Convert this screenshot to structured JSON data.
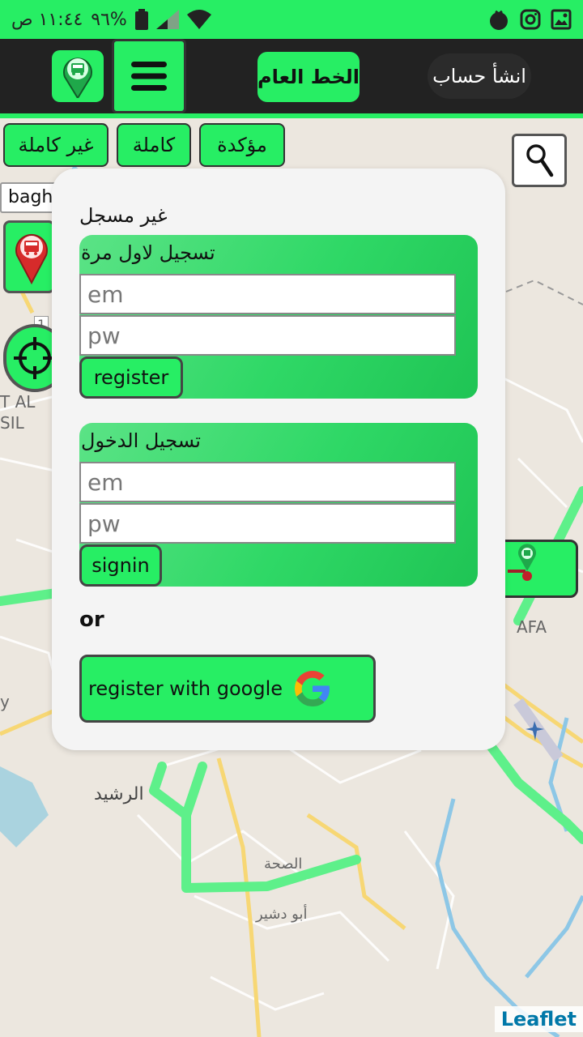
{
  "status_bar": {
    "time": "١١:٤٤ ص",
    "battery_percent": "٩٦%",
    "icons": [
      "wifi-icon",
      "signal-icon",
      "battery-icon",
      "tomato-app-icon",
      "instagram-icon",
      "gallery-icon"
    ]
  },
  "app_bar": {
    "create_account": "انشأ حساب",
    "main_line": "الخط العام",
    "menu_icon": "hamburger-menu-icon",
    "bus_pin_icon": "bus-pin-icon"
  },
  "filters": {
    "confirmed": "مؤكدة",
    "complete": "كاملة",
    "incomplete": "غير كاملة"
  },
  "map": {
    "search_value": "bagh",
    "labels": {
      "rashid": "الرشيد",
      "sihha": "الصحة",
      "abu_dshir": "أبو دشير",
      "al": "T AL",
      "sil": "SIL",
      "afa": "AFA",
      "y": "y",
      "one": "1"
    },
    "attribution": "Leaflet"
  },
  "modal": {
    "status": "غير مسجل",
    "register": {
      "title": "تسجيل لاول مرة",
      "email_placeholder": "em",
      "password_placeholder": "pw",
      "button": "register"
    },
    "signin": {
      "title": "تسجيل الدخول",
      "email_placeholder": "em",
      "password_placeholder": "pw",
      "button": "signin"
    },
    "or": "or",
    "google_button": "register with google"
  },
  "colors": {
    "accent": "#27ee64",
    "appbar": "#222222",
    "route": "#5ef08a",
    "water": "#aad3df"
  }
}
